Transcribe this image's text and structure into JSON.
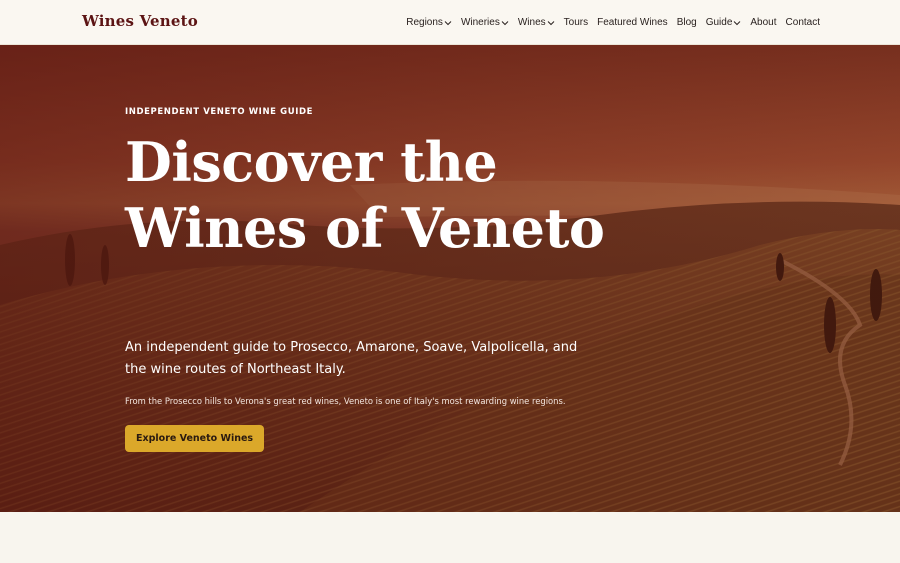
{
  "header": {
    "brand": "Wines Veneto",
    "nav": [
      {
        "label": "Regions",
        "dropdown": true
      },
      {
        "label": "Wineries",
        "dropdown": true
      },
      {
        "label": "Wines",
        "dropdown": true
      },
      {
        "label": "Tours",
        "dropdown": false
      },
      {
        "label": "Featured Wines",
        "dropdown": false
      },
      {
        "label": "Blog",
        "dropdown": false
      },
      {
        "label": "Guide",
        "dropdown": true
      },
      {
        "label": "About",
        "dropdown": false
      },
      {
        "label": "Contact",
        "dropdown": false
      }
    ]
  },
  "hero": {
    "eyebrow": "INDEPENDENT VENETO WINE GUIDE",
    "headline": "Discover the Wines of Veneto",
    "subhead": "An independent guide to Prosecco, Amarone, Soave, Valpolicella, and the wine routes of Northeast Italy.",
    "description": "From the Prosecco hills to Verona's great red wines, Veneto is one of Italy's most rewarding wine regions.",
    "cta_label": "Explore Veneto Wines"
  },
  "colors": {
    "brand": "#5c1414",
    "cta": "#dba82a",
    "hero_overlay": "#6a2a1c",
    "page_bg": "#f8f5ee"
  },
  "icons": {
    "dropdown": "chevron-down-icon",
    "hero_image": "vineyard-landscape"
  }
}
